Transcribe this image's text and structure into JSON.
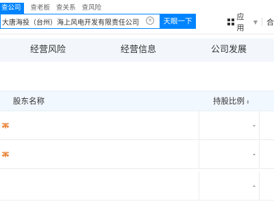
{
  "header": {
    "search_tabs": [
      "查公司",
      "查老板",
      "查关系",
      "查风险"
    ],
    "search": {
      "value": "大唐海投（台州）海上风电开发有限责任公司",
      "placeholder": ""
    },
    "search_button_label": "天眼一下",
    "apps_label": "应用",
    "cut_label": "合"
  },
  "tabs": [
    "经营风险",
    "经营信息",
    "公司发展"
  ],
  "table": {
    "columns": [
      "股东名称",
      "持股比例"
    ],
    "rows": [
      {
        "name": "",
        "ratio": "-"
      },
      {
        "name": "",
        "ratio": "-"
      },
      {
        "name": "",
        "ratio": "-"
      }
    ]
  },
  "colors": {
    "accent": "#0084ff",
    "tabbar_bg": "#f3f7fc",
    "table_head_bg": "#f2f8ff",
    "holder_icon": "#e8731c"
  }
}
